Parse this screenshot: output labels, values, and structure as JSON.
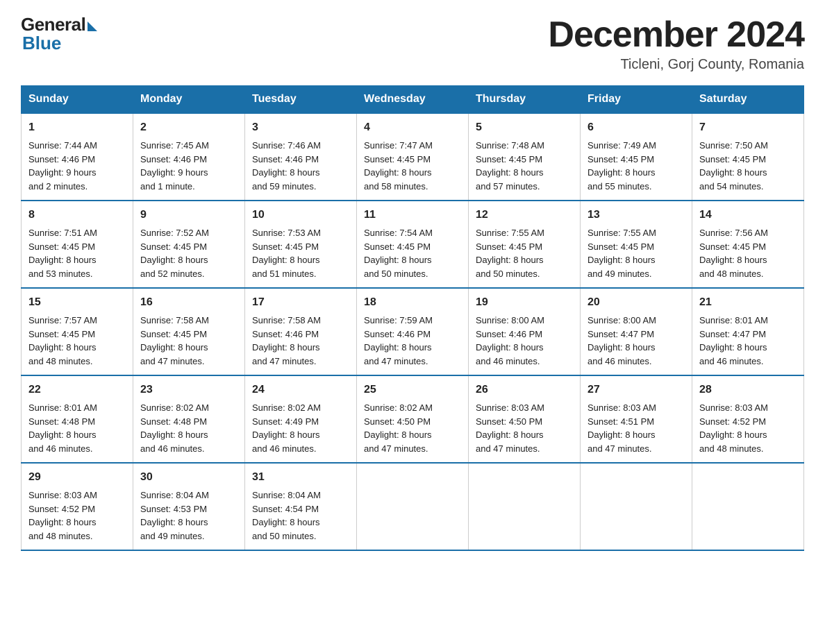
{
  "header": {
    "logo_general": "General",
    "logo_blue": "Blue",
    "main_title": "December 2024",
    "subtitle": "Ticleni, Gorj County, Romania"
  },
  "days_of_week": [
    "Sunday",
    "Monday",
    "Tuesday",
    "Wednesday",
    "Thursday",
    "Friday",
    "Saturday"
  ],
  "weeks": [
    [
      {
        "day": "1",
        "sunrise": "7:44 AM",
        "sunset": "4:46 PM",
        "daylight": "9 hours and 2 minutes."
      },
      {
        "day": "2",
        "sunrise": "7:45 AM",
        "sunset": "4:46 PM",
        "daylight": "9 hours and 1 minute."
      },
      {
        "day": "3",
        "sunrise": "7:46 AM",
        "sunset": "4:46 PM",
        "daylight": "8 hours and 59 minutes."
      },
      {
        "day": "4",
        "sunrise": "7:47 AM",
        "sunset": "4:45 PM",
        "daylight": "8 hours and 58 minutes."
      },
      {
        "day": "5",
        "sunrise": "7:48 AM",
        "sunset": "4:45 PM",
        "daylight": "8 hours and 57 minutes."
      },
      {
        "day": "6",
        "sunrise": "7:49 AM",
        "sunset": "4:45 PM",
        "daylight": "8 hours and 55 minutes."
      },
      {
        "day": "7",
        "sunrise": "7:50 AM",
        "sunset": "4:45 PM",
        "daylight": "8 hours and 54 minutes."
      }
    ],
    [
      {
        "day": "8",
        "sunrise": "7:51 AM",
        "sunset": "4:45 PM",
        "daylight": "8 hours and 53 minutes."
      },
      {
        "day": "9",
        "sunrise": "7:52 AM",
        "sunset": "4:45 PM",
        "daylight": "8 hours and 52 minutes."
      },
      {
        "day": "10",
        "sunrise": "7:53 AM",
        "sunset": "4:45 PM",
        "daylight": "8 hours and 51 minutes."
      },
      {
        "day": "11",
        "sunrise": "7:54 AM",
        "sunset": "4:45 PM",
        "daylight": "8 hours and 50 minutes."
      },
      {
        "day": "12",
        "sunrise": "7:55 AM",
        "sunset": "4:45 PM",
        "daylight": "8 hours and 50 minutes."
      },
      {
        "day": "13",
        "sunrise": "7:55 AM",
        "sunset": "4:45 PM",
        "daylight": "8 hours and 49 minutes."
      },
      {
        "day": "14",
        "sunrise": "7:56 AM",
        "sunset": "4:45 PM",
        "daylight": "8 hours and 48 minutes."
      }
    ],
    [
      {
        "day": "15",
        "sunrise": "7:57 AM",
        "sunset": "4:45 PM",
        "daylight": "8 hours and 48 minutes."
      },
      {
        "day": "16",
        "sunrise": "7:58 AM",
        "sunset": "4:45 PM",
        "daylight": "8 hours and 47 minutes."
      },
      {
        "day": "17",
        "sunrise": "7:58 AM",
        "sunset": "4:46 PM",
        "daylight": "8 hours and 47 minutes."
      },
      {
        "day": "18",
        "sunrise": "7:59 AM",
        "sunset": "4:46 PM",
        "daylight": "8 hours and 47 minutes."
      },
      {
        "day": "19",
        "sunrise": "8:00 AM",
        "sunset": "4:46 PM",
        "daylight": "8 hours and 46 minutes."
      },
      {
        "day": "20",
        "sunrise": "8:00 AM",
        "sunset": "4:47 PM",
        "daylight": "8 hours and 46 minutes."
      },
      {
        "day": "21",
        "sunrise": "8:01 AM",
        "sunset": "4:47 PM",
        "daylight": "8 hours and 46 minutes."
      }
    ],
    [
      {
        "day": "22",
        "sunrise": "8:01 AM",
        "sunset": "4:48 PM",
        "daylight": "8 hours and 46 minutes."
      },
      {
        "day": "23",
        "sunrise": "8:02 AM",
        "sunset": "4:48 PM",
        "daylight": "8 hours and 46 minutes."
      },
      {
        "day": "24",
        "sunrise": "8:02 AM",
        "sunset": "4:49 PM",
        "daylight": "8 hours and 46 minutes."
      },
      {
        "day": "25",
        "sunrise": "8:02 AM",
        "sunset": "4:50 PM",
        "daylight": "8 hours and 47 minutes."
      },
      {
        "day": "26",
        "sunrise": "8:03 AM",
        "sunset": "4:50 PM",
        "daylight": "8 hours and 47 minutes."
      },
      {
        "day": "27",
        "sunrise": "8:03 AM",
        "sunset": "4:51 PM",
        "daylight": "8 hours and 47 minutes."
      },
      {
        "day": "28",
        "sunrise": "8:03 AM",
        "sunset": "4:52 PM",
        "daylight": "8 hours and 48 minutes."
      }
    ],
    [
      {
        "day": "29",
        "sunrise": "8:03 AM",
        "sunset": "4:52 PM",
        "daylight": "8 hours and 48 minutes."
      },
      {
        "day": "30",
        "sunrise": "8:04 AM",
        "sunset": "4:53 PM",
        "daylight": "8 hours and 49 minutes."
      },
      {
        "day": "31",
        "sunrise": "8:04 AM",
        "sunset": "4:54 PM",
        "daylight": "8 hours and 50 minutes."
      },
      null,
      null,
      null,
      null
    ]
  ],
  "labels": {
    "sunrise": "Sunrise:",
    "sunset": "Sunset:",
    "daylight": "Daylight:"
  }
}
